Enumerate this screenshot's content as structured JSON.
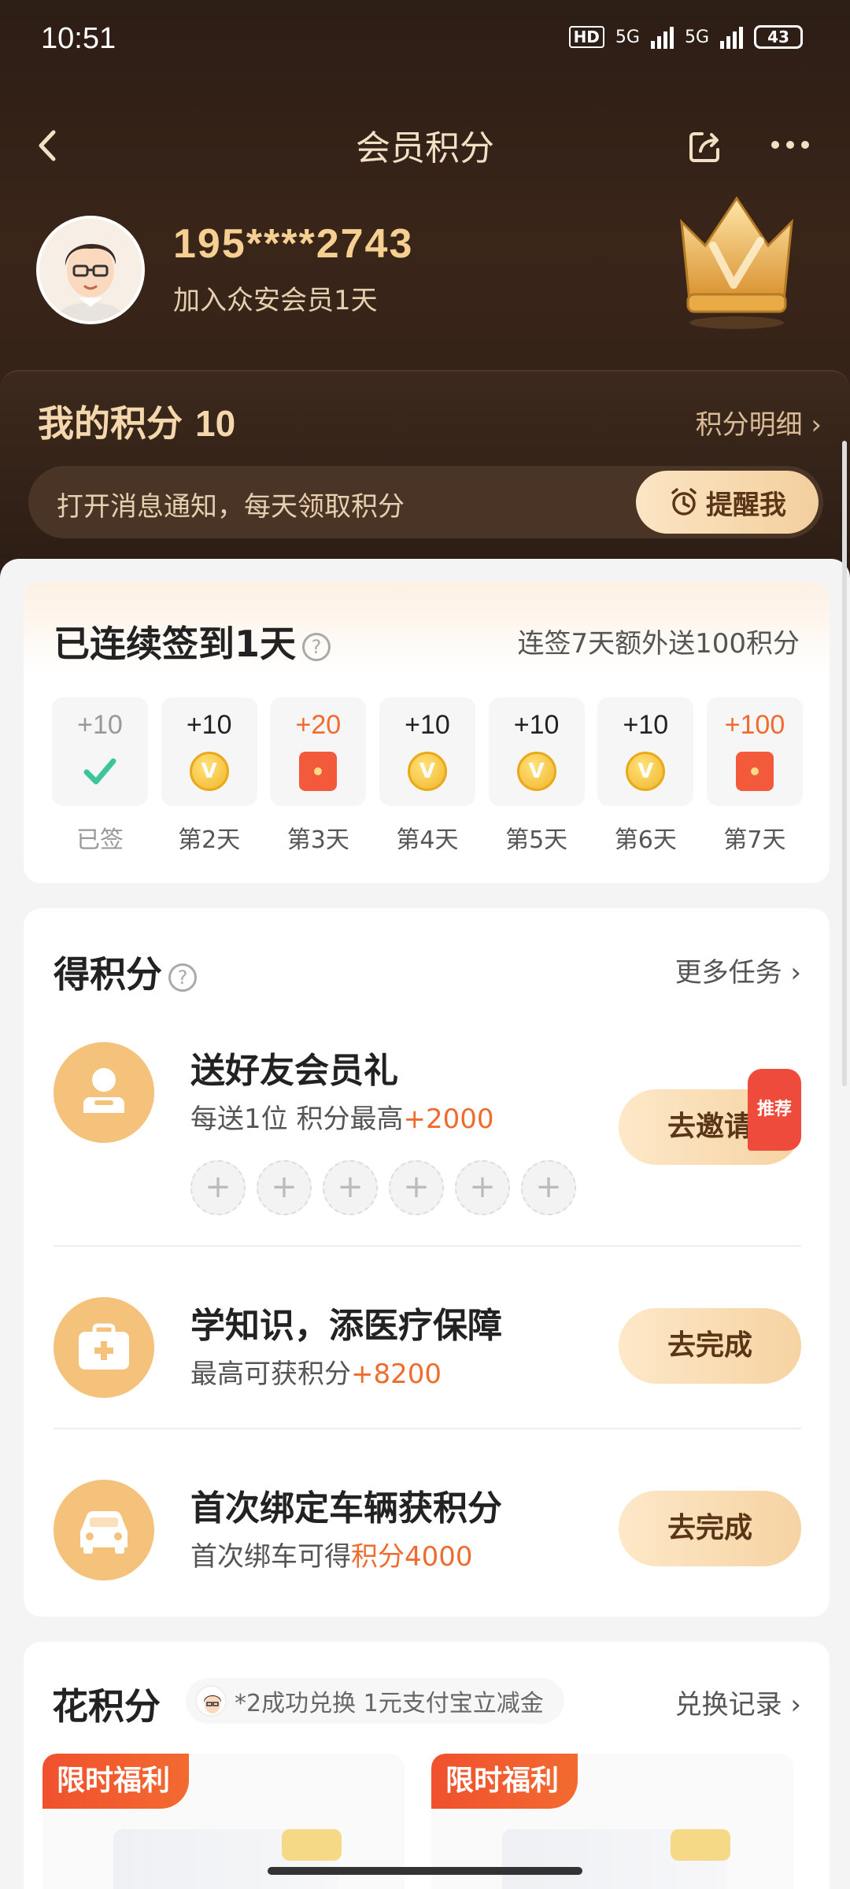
{
  "status_bar": {
    "time": "10:51",
    "hd": "HD",
    "network_1": "5G",
    "network_2": "5G",
    "battery": "43"
  },
  "nav": {
    "title": "会员积分"
  },
  "profile": {
    "phone": "195****2743",
    "member_days": "加入众安会员1天"
  },
  "points": {
    "label": "我的积分",
    "value": "10",
    "detail_link": "积分明细",
    "notify_text": "打开消息通知，每天领取积分",
    "remind_button": "提醒我"
  },
  "checkin": {
    "title": "已连续签到1天",
    "bonus": "连签7天额外送100积分",
    "days": [
      {
        "points": "+10",
        "label": "已签",
        "state": "done",
        "icon": "check-icon"
      },
      {
        "points": "+10",
        "label": "第2天",
        "state": "normal",
        "icon": "coin-icon"
      },
      {
        "points": "+20",
        "label": "第3天",
        "state": "special",
        "icon": "red-packet-icon"
      },
      {
        "points": "+10",
        "label": "第4天",
        "state": "normal",
        "icon": "coin-icon"
      },
      {
        "points": "+10",
        "label": "第5天",
        "state": "normal",
        "icon": "coin-icon"
      },
      {
        "points": "+10",
        "label": "第6天",
        "state": "normal",
        "icon": "coin-icon"
      },
      {
        "points": "+100",
        "label": "第7天",
        "state": "special",
        "icon": "red-packet-icon"
      }
    ]
  },
  "earn": {
    "title": "得积分",
    "more": "更多任务",
    "tasks": [
      {
        "title": "送好友会员礼",
        "sub_prefix": "每送1位 积分最高",
        "sub_highlight": "+2000",
        "button": "去邀请",
        "badge": "推荐",
        "icon": "person-gift-icon"
      },
      {
        "title": "学知识，添医疗保障",
        "sub_prefix": "最高可获积分",
        "sub_highlight": "+8200",
        "button": "去完成",
        "icon": "medical-kit-icon"
      },
      {
        "title": "首次绑定车辆获积分",
        "sub_prefix": "首次绑车可得",
        "sub_highlight": "积分4000",
        "button": "去完成",
        "icon": "car-icon"
      }
    ]
  },
  "spend": {
    "title": "花积分",
    "ticker": "*2成功兑换 1元支付宝立减金",
    "more": "兑换记录",
    "offers": [
      {
        "tag": "限时福利"
      },
      {
        "tag": "限时福利"
      }
    ]
  },
  "colors": {
    "accent": "#ef6c2e",
    "gold": "#f6cf92",
    "hero_bg": "#2c1d15",
    "button_gold": "#f3cf9e"
  }
}
